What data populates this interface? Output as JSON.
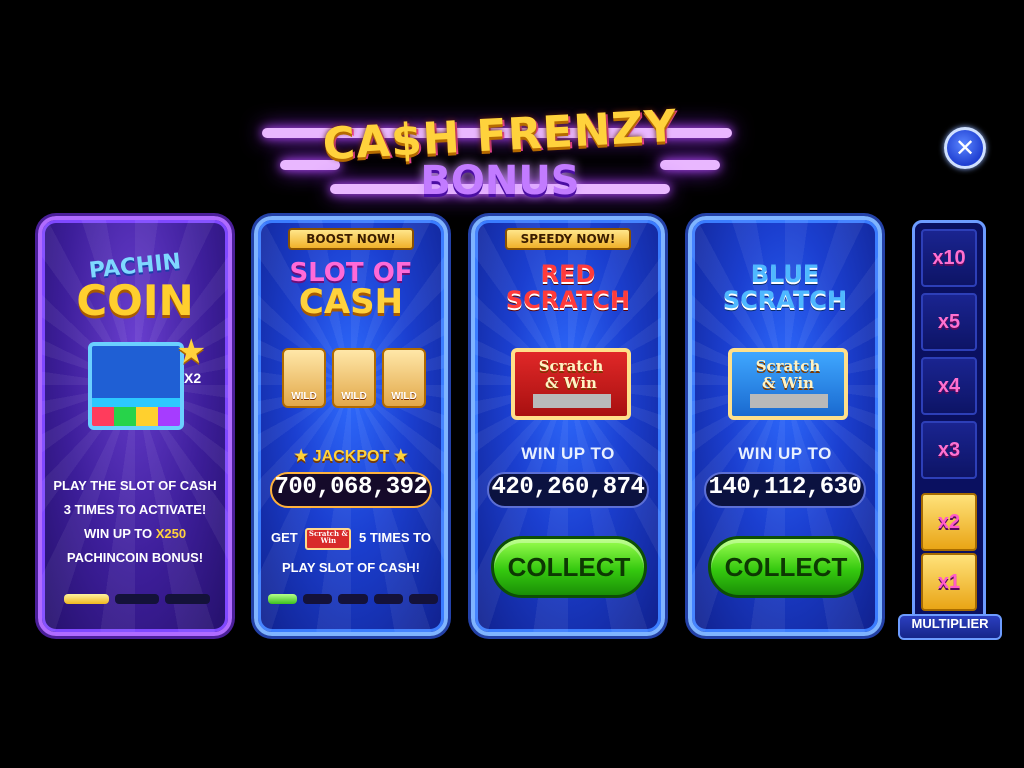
{
  "header": {
    "title_line1": "CA$H FRENZY",
    "title_line2": "BONUS",
    "close_icon": "close-icon"
  },
  "cards": {
    "pachincoin": {
      "title_line1": "PACHIN",
      "title_line2": "COIN",
      "badge": "X2",
      "desc_line1": "PLAY THE SLOT OF CASH",
      "desc_line2": "3 TIMES TO ACTIVATE!",
      "desc_line3_prefix": "WIN UP TO ",
      "desc_line3_highlight": "X250",
      "desc_line4": "PACHINCOIN BONUS!",
      "progress_total": 3,
      "progress_filled": 1
    },
    "slot_of_cash": {
      "ribbon": "BOOST NOW!",
      "title_line1": "SLOT OF",
      "title_line2": "CASH",
      "reel_label": "WILD",
      "jackpot_label": "JACKPOT",
      "jackpot_amount": "700,068,392",
      "get_prefix": "GET",
      "get_suffix": "5 TIMES TO",
      "get_line2": "PLAY SLOT OF CASH!",
      "ticket_text": "Scratch & Win",
      "progress_total": 5,
      "progress_filled": 1
    },
    "red_scratch": {
      "ribbon": "SPEEDY NOW!",
      "title_line1": "RED",
      "title_line2": "SCRATCH",
      "ticket_line1": "Scratch",
      "ticket_line2": "& Win",
      "win_up_to": "WIN UP TO",
      "amount": "420,260,874",
      "collect": "COLLECT"
    },
    "blue_scratch": {
      "title_line1": "BLUE",
      "title_line2": "SCRATCH",
      "ticket_line1": "Scratch",
      "ticket_line2": "& Win",
      "win_up_to": "WIN UP TO",
      "amount": "140,112,630",
      "collect": "COLLECT"
    }
  },
  "multiplier": {
    "label": "MULTIPLIER",
    "levels": [
      "x10",
      "x5",
      "x4",
      "x3",
      "x2",
      "x1"
    ],
    "lit_levels": [
      "x2",
      "x1"
    ]
  }
}
